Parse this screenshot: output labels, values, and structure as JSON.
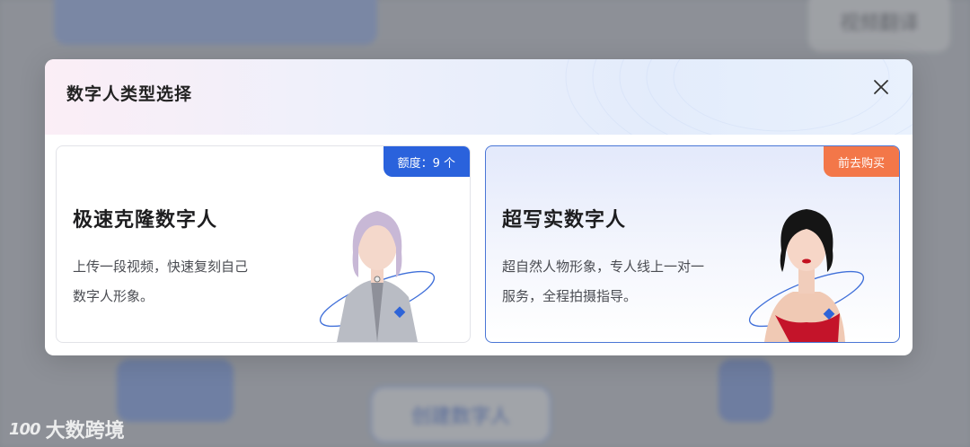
{
  "background": {
    "top_button": "视频翻译",
    "create_button": "创建数字人",
    "logo_text": "大数跨境",
    "logo_mark": "100"
  },
  "modal": {
    "title": "数字人类型选择",
    "close_icon": "close-icon",
    "cards": [
      {
        "title": "极速克隆数字人",
        "description_line1": "上传一段视频，快速复刻自己",
        "description_line2": "数字人形象。",
        "badge": "额度：9 个",
        "badge_color": "#2a62dc",
        "image": "silver-haired-avatar"
      },
      {
        "title": "超写实数字人",
        "description_line1": "超自然人物形象，专人线上一对一",
        "description_line2": "服务，全程拍摄指导。",
        "badge": "前去购买",
        "badge_color": "#f37749",
        "image": "dark-haired-avatar"
      }
    ]
  }
}
